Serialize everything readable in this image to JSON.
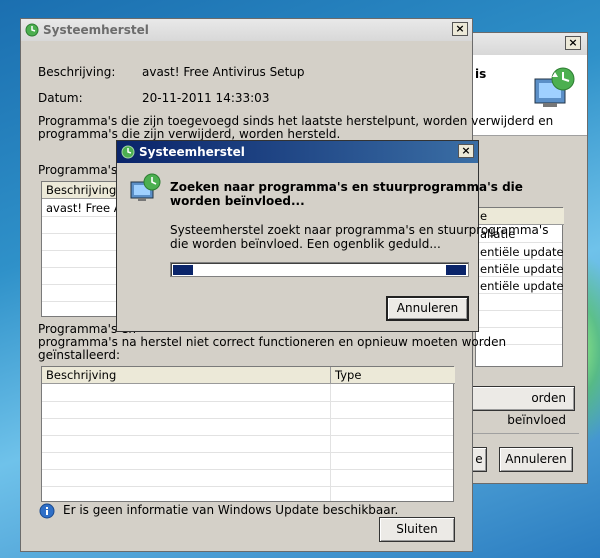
{
  "back_window": {
    "visible_title_fragment": "is",
    "close": "×",
    "header": "e",
    "column_header_fragment": "allatie",
    "rows": [
      "entiële update",
      "entiële update",
      "entiële update"
    ],
    "affected_button": "orden beïnvloed",
    "prev_fragment": "e",
    "cancel": "Annuleren"
  },
  "main_window": {
    "title": "Systeemherstel",
    "close": "×",
    "description_label": "Beschrijving:",
    "description_value": "avast! Free Antivirus Setup",
    "date_label": "Datum:",
    "date_value": "20-11-2011 14:33:03",
    "intro_line1": "Programma's die zijn toegevoegd sinds het laatste herstelpunt, worden verwijderd en",
    "intro_line2": "programma's die zijn verwijderd, worden hersteld.",
    "list1_label": "Programma's en",
    "list1_header": "Beschrijving",
    "list1_row": "avast! Free An",
    "list2_line1": "Programma's en",
    "list2_line2": "programma's na herstel niet correct functioneren en opnieuw moeten worden",
    "list2_line3": "geïnstalleerd:",
    "col_desc": "Beschrijving",
    "col_type": "Type",
    "info_text": "Er is geen informatie van Windows Update beschikbaar.",
    "close_button": "Sluiten"
  },
  "dialog": {
    "title": "Systeemherstel",
    "close": "×",
    "heading_line1": "Zoeken naar programma's en stuurprogramma's die",
    "heading_line2": "worden beïnvloed...",
    "body_line1": "Systeemherstel zoekt naar programma's en stuurprogramma's",
    "body_line2": "die worden beïnvloed. Een ogenblik geduld...",
    "cancel_button": "Annuleren",
    "progress_note": "indeterminate"
  },
  "colors": {
    "title_active_start": "#0a246a",
    "title_active_end": "#3a6ea5",
    "window_bg": "#d4d0c8",
    "progress_block": "#0a246a"
  }
}
